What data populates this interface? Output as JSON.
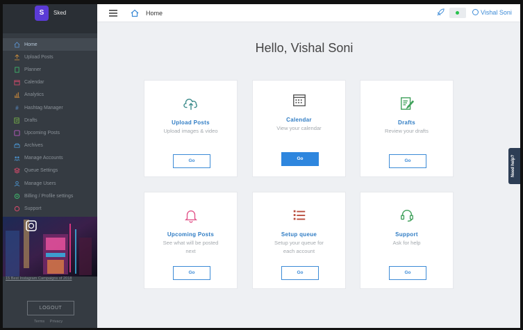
{
  "app": {
    "name": "Sked"
  },
  "sidebar": {
    "items": [
      {
        "label": "Home",
        "icon": "home-icon",
        "color": "#5b8fc9"
      },
      {
        "label": "Upload Posts",
        "icon": "upload-icon",
        "color": "#c98b3a"
      },
      {
        "label": "Planner",
        "icon": "planner-icon",
        "color": "#3fb36b"
      },
      {
        "label": "Calendar",
        "icon": "calendar-icon",
        "color": "#d04a6a"
      },
      {
        "label": "Analytics",
        "icon": "analytics-icon",
        "color": "#c9883a"
      },
      {
        "label": "Hashtag Manager",
        "icon": "hashtag-icon",
        "color": "#5b8fc9"
      },
      {
        "label": "Drafts",
        "icon": "drafts-icon",
        "color": "#7ab648"
      },
      {
        "label": "Upcoming Posts",
        "icon": "upcoming-icon",
        "color": "#b85ac0"
      },
      {
        "label": "Archives",
        "icon": "archives-icon",
        "color": "#4a90c9"
      },
      {
        "label": "Manage Accounts",
        "icon": "accounts-icon",
        "color": "#4a90c9"
      },
      {
        "label": "Queue Settings",
        "icon": "queue-icon",
        "color": "#d04a6a"
      },
      {
        "label": "Manage Users",
        "icon": "users-icon",
        "color": "#4a90c9"
      },
      {
        "label": "Billing / Profile settings",
        "icon": "billing-icon",
        "color": "#3fb36b"
      },
      {
        "label": "Support",
        "icon": "support-icon",
        "color": "#d04a6a"
      }
    ],
    "promo_caption": "15 Best Instagram Campaigns of 2018",
    "logout_label": "LOGOUT",
    "footer": {
      "terms": "Terms",
      "privacy": "Privacy"
    }
  },
  "topbar": {
    "breadcrumb": "Home",
    "user_name": "Vishal Soni"
  },
  "main": {
    "greeting": "Hello, Vishal Soni",
    "cards": [
      {
        "title": "Upload Posts",
        "desc": "Upload images & video",
        "button": "Go",
        "icon": "upload-cloud-icon",
        "color": "#3a8a8a"
      },
      {
        "title": "Calendar",
        "desc": "View your calendar",
        "button": "Go",
        "icon": "calendar-icon",
        "color": "#555555"
      },
      {
        "title": "Drafts",
        "desc": "Review your drafts",
        "button": "Go",
        "icon": "drafts-icon",
        "color": "#3fa05a"
      },
      {
        "title": "Upcoming Posts",
        "desc": "See what will be posted next",
        "button": "Go",
        "icon": "bell-icon",
        "color": "#e2558a"
      },
      {
        "title": "Setup queue",
        "desc": "Setup your queue for each account",
        "button": "Go",
        "icon": "queue-list-icon",
        "color": "#b84a3a"
      },
      {
        "title": "Support",
        "desc": "Ask for help",
        "button": "Go",
        "icon": "headset-icon",
        "color": "#3fa05a"
      }
    ]
  },
  "help_tab": "Need help?",
  "colors": {
    "accent": "#2e86de",
    "sidebar_bg": "#353b42"
  }
}
